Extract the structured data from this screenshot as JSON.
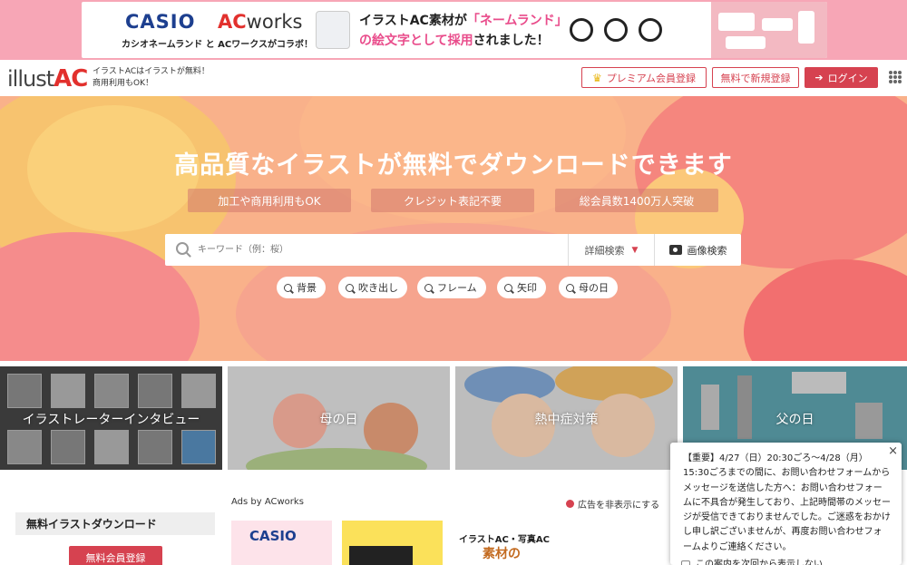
{
  "banner": {
    "brand1": "CASIO",
    "brand2_ac": "AC",
    "brand2_works": "works",
    "sub": "カシオネームランド と ACワークスがコラボ！",
    "line1_pre": "イラストAC素材が",
    "line1_hl": "「ネームランド」",
    "line2_hl": "の絵文字として採用",
    "line2_post": "されました！"
  },
  "header": {
    "logo_a": "illust",
    "logo_b": "AC",
    "tagline1": "イラストACはイラストが無料！",
    "tagline2": "商用利用もOK！",
    "premium": "プレミアム会員登録",
    "signup": "無料で新規登録",
    "login": "ログイン"
  },
  "hero": {
    "title": "高品質なイラストが無料でダウンロードできます",
    "pills": [
      "加工や商用利用もOK",
      "クレジット表記不要",
      "総会員数1400万人突破"
    ],
    "search_placeholder": "キーワード（例：桜）",
    "advanced": "詳細検索",
    "image_search": "画像検索",
    "tags": [
      "背景",
      "吹き出し",
      "フレーム",
      "矢印",
      "母の日"
    ]
  },
  "tiles": [
    "イラストレーターインタビュー",
    "母の日",
    "熱中症対策",
    "父の日"
  ],
  "sidebar": {
    "title": "無料イラストダウンロード",
    "button": "無料会員登録"
  },
  "ads": {
    "label": "Ads by ACworks",
    "hide": "広告を非表示にする",
    "card1": "CASIO",
    "card3": "イラストAC・写真AC",
    "card3b": "素材の"
  },
  "notice": {
    "text": "【重要】4/27（日）20:30ごろ～4/28（月）15:30ごろまでの間に、お問い合わせフォームからメッセージを送信した方へ：お問い合わせフォームに不具合が発生しており、上記時間帯のメッセージが受信できておりませんでした。ご迷惑をおかけし申し訳ございませんが、再度お問い合わせフォームよりご連絡ください。",
    "checkbox": "この案内を次回から表示しない",
    "close": "×"
  },
  "colors": {
    "accent": "#d64250",
    "hero_bg": "#f9b18a"
  }
}
